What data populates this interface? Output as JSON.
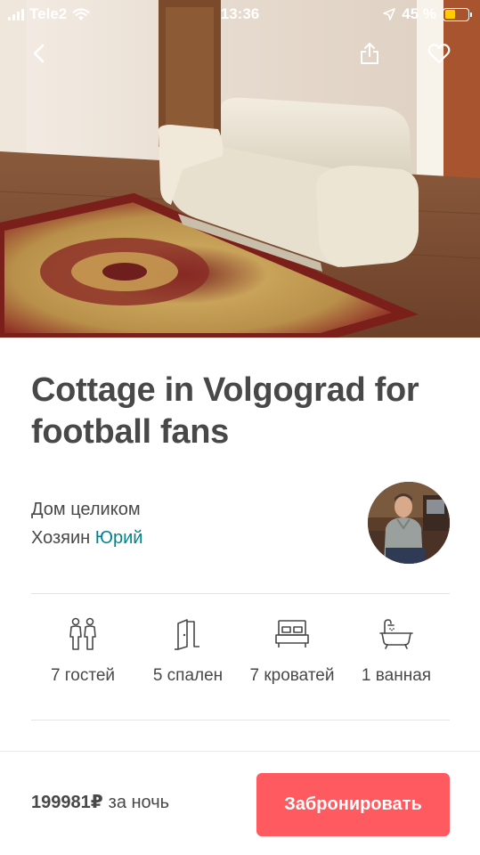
{
  "status_bar": {
    "carrier": "Tele2",
    "time": "13:36",
    "battery_percent": "45 %",
    "battery_level": 0.45
  },
  "colors": {
    "accent": "#ff5a5f",
    "host_link": "#008489",
    "text": "#484848",
    "divider": "#e4e4e4"
  },
  "toolbar": {
    "back_icon": "chevron-left-icon",
    "share_icon": "share-icon",
    "favorite_icon": "heart-icon"
  },
  "listing": {
    "title": "Cottage in Volgograd for football fans",
    "property_type": "Дом целиком",
    "host_prefix": "Хозяин",
    "host_name": "Юрий"
  },
  "amenities": [
    {
      "icon": "guests-icon",
      "label": "7 гостей"
    },
    {
      "icon": "door-icon",
      "label": "5 спален"
    },
    {
      "icon": "bed-icon",
      "label": "7 кроватей"
    },
    {
      "icon": "bathtub-icon",
      "label": "1 ванная"
    }
  ],
  "booking": {
    "price": "199981₽",
    "per_night": "за ночь",
    "book_label": "Забронировать"
  }
}
